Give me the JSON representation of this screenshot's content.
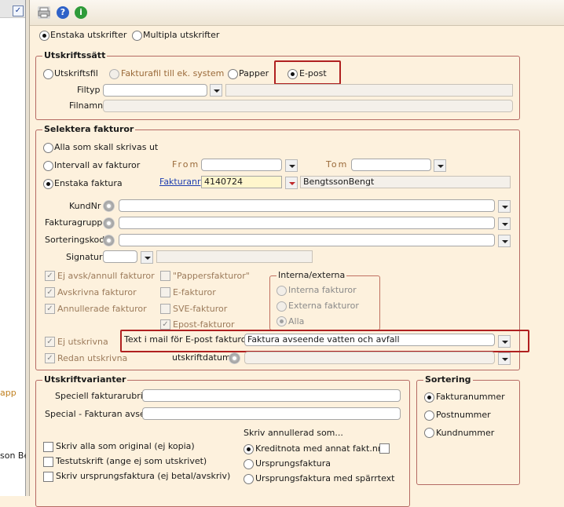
{
  "left": {
    "frag_app": "app",
    "frag_name": "son Be"
  },
  "top_options": {
    "single": "Enstaka utskrifter",
    "multiple": "Multipla utskrifter"
  },
  "utskriftssatt": {
    "title": "Utskriftssätt",
    "opt_file": "Utskriftsfil",
    "opt_invoicefile": "Fakturafil till ek. system",
    "opt_paper": "Papper",
    "opt_email": "E-post",
    "filetype_label": "Filtyp",
    "filename_label": "Filnamn"
  },
  "select": {
    "title": "Selektera fakturor",
    "opt_all": "Alla som skall skrivas ut",
    "opt_interval": "Intervall av fakturor",
    "opt_single": "Enstaka faktura",
    "from_label": "From",
    "tom_label": "Tom",
    "fakturanr_label": "Fakturanr",
    "fakturanr_value": "4140724",
    "customer_name": "BengtssonBengt",
    "kundnr_label": "KundNr",
    "fakturagrupp_label": "Fakturagrupp",
    "sorteringskod_label": "Sorteringskod",
    "signatur_label": "Signatur",
    "cb_ej_avsk": "Ej avsk/annull fakturor",
    "cb_avskrivna": "Avskrivna fakturor",
    "cb_annullerade": "Annullerade fakturor",
    "cb_papper": "\"Pappersfakturor\"",
    "cb_efakt": "E-fakturor",
    "cb_sve": "SVE-fakturor",
    "cb_epost": "Epost-fakturor",
    "interna_title": "Interna/externa",
    "opt_interna": "Interna fakturor",
    "opt_externa": "Externa fakturor",
    "opt_alla": "Alla",
    "cb_ej_utskrivna": "Ej utskrivna",
    "cb_redan": "Redan utskrivna",
    "utskriftdatum_label": "utskriftdatum",
    "mailtext_label": "Text i mail för E-post fakturor",
    "mailtext_value": "Faktura avseende vatten och avfall"
  },
  "varianter": {
    "title": "Utskriftvarianter",
    "rubrik_label": "Speciell fakturarubrik",
    "avser_label": "Special - Fakturan avser",
    "cb_original": "Skriv alla som original (ej kopia)",
    "cb_test": "Testutskrift (ange ej som utskrivet)",
    "cb_urspr": "Skriv ursprungsfaktura (ej betal/avskriv)",
    "annullerad_title": "Skriv annullerad som...",
    "opt_kreditnota": "Kreditnota med annat fakt.nr",
    "opt_ursprungs": "Ursprungsfaktura",
    "opt_sparrtext": "Ursprungsfaktura med spärrtext"
  },
  "sortering": {
    "title": "Sortering",
    "opt_fakturanummer": "Fakturanummer",
    "opt_postnummer": "Postnummer",
    "opt_kundnummer": "Kundnummer"
  }
}
